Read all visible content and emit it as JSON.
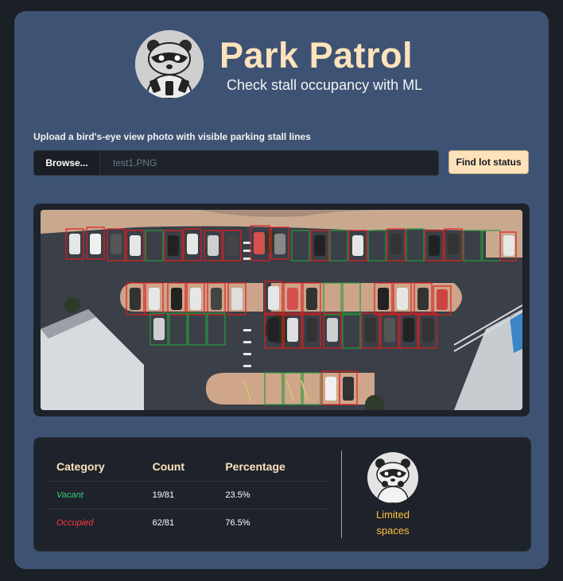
{
  "header": {
    "title": "Park Patrol",
    "subtitle": "Check stall occupancy with ML",
    "logo_icon": "raccoon-logo-icon"
  },
  "upload": {
    "label": "Upload a bird's-eye view photo with visible parking stall lines",
    "browse_label": "Browse...",
    "filename": "test1.PNG",
    "submit_label": "Find lot status"
  },
  "image": {
    "description_icon": "aerial-parking-lot-image"
  },
  "results": {
    "headers": [
      "Category",
      "Count",
      "Percentage"
    ],
    "rows": [
      {
        "category": "Vacant",
        "count": "19/81",
        "percentage": "23.5%"
      },
      {
        "category": "Occupied",
        "count": "62/81",
        "percentage": "76.5%"
      }
    ],
    "status_icon": "worried-raccoon-icon",
    "status_line1": "Limited",
    "status_line2": "spaces"
  },
  "colors": {
    "accent": "#fde2bb",
    "vacant": "#38d27a",
    "occupied": "#ff3b3b",
    "status": "#ffc23b",
    "card": "#3e5373"
  }
}
